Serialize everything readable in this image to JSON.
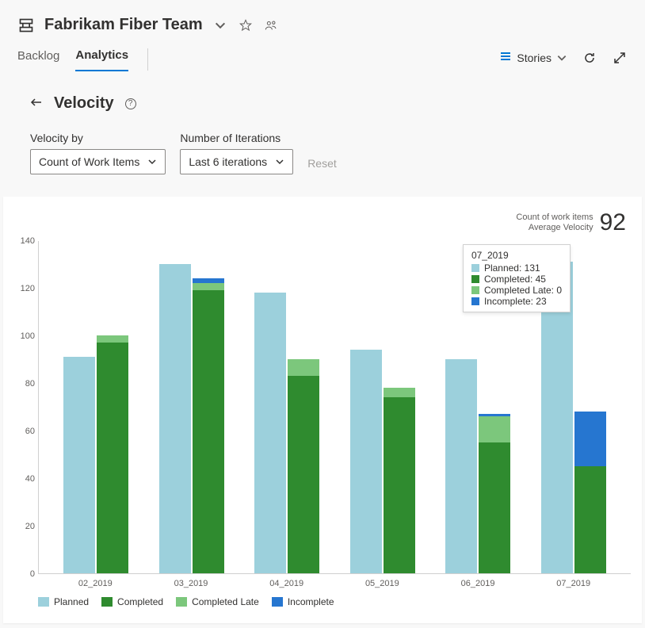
{
  "header": {
    "team_name": "Fabrikam Fiber Team"
  },
  "tabs": {
    "backlog": "Backlog",
    "analytics": "Analytics",
    "active": "analytics"
  },
  "tools": {
    "stories_label": "Stories"
  },
  "section": {
    "title": "Velocity",
    "help": "?"
  },
  "controls": {
    "velocity_by_label": "Velocity by",
    "velocity_by_value": "Count of Work Items",
    "iterations_label": "Number of Iterations",
    "iterations_value": "Last 6 iterations",
    "reset_label": "Reset"
  },
  "summary": {
    "line1": "Count of work items",
    "line2": "Average Velocity",
    "value": "92"
  },
  "legend": {
    "planned": "Planned",
    "completed": "Completed",
    "completed_late": "Completed Late",
    "incomplete": "Incomplete"
  },
  "tooltip": {
    "title": "07_2019",
    "rows": [
      {
        "label": "Planned: 131",
        "color": "#9cd0dc"
      },
      {
        "label": "Completed: 45",
        "color": "#2f8b2f"
      },
      {
        "label": "Completed Late: 0",
        "color": "#7cc77c"
      },
      {
        "label": "Incomplete: 23",
        "color": "#2676d0"
      }
    ]
  },
  "chart_data": {
    "type": "bar",
    "title": "Velocity",
    "ylabel": "Count of work items",
    "ylim": [
      0,
      140
    ],
    "y_ticks": [
      0,
      20,
      40,
      60,
      80,
      100,
      120,
      140
    ],
    "categories": [
      "02_2019",
      "03_2019",
      "04_2019",
      "05_2019",
      "06_2019",
      "07_2019"
    ],
    "series": [
      {
        "name": "Planned",
        "color": "#9cd0dc",
        "values": [
          91,
          130,
          118,
          94,
          90,
          131
        ]
      },
      {
        "name": "Completed",
        "color": "#2f8b2f",
        "values": [
          97,
          119,
          83,
          74,
          55,
          45
        ]
      },
      {
        "name": "Completed Late",
        "color": "#7cc77c",
        "values": [
          3,
          3,
          7,
          4,
          11,
          0
        ]
      },
      {
        "name": "Incomplete",
        "color": "#2676d0",
        "values": [
          0,
          2,
          0,
          0,
          1,
          23
        ]
      }
    ],
    "tooltip_iteration": "07_2019"
  }
}
